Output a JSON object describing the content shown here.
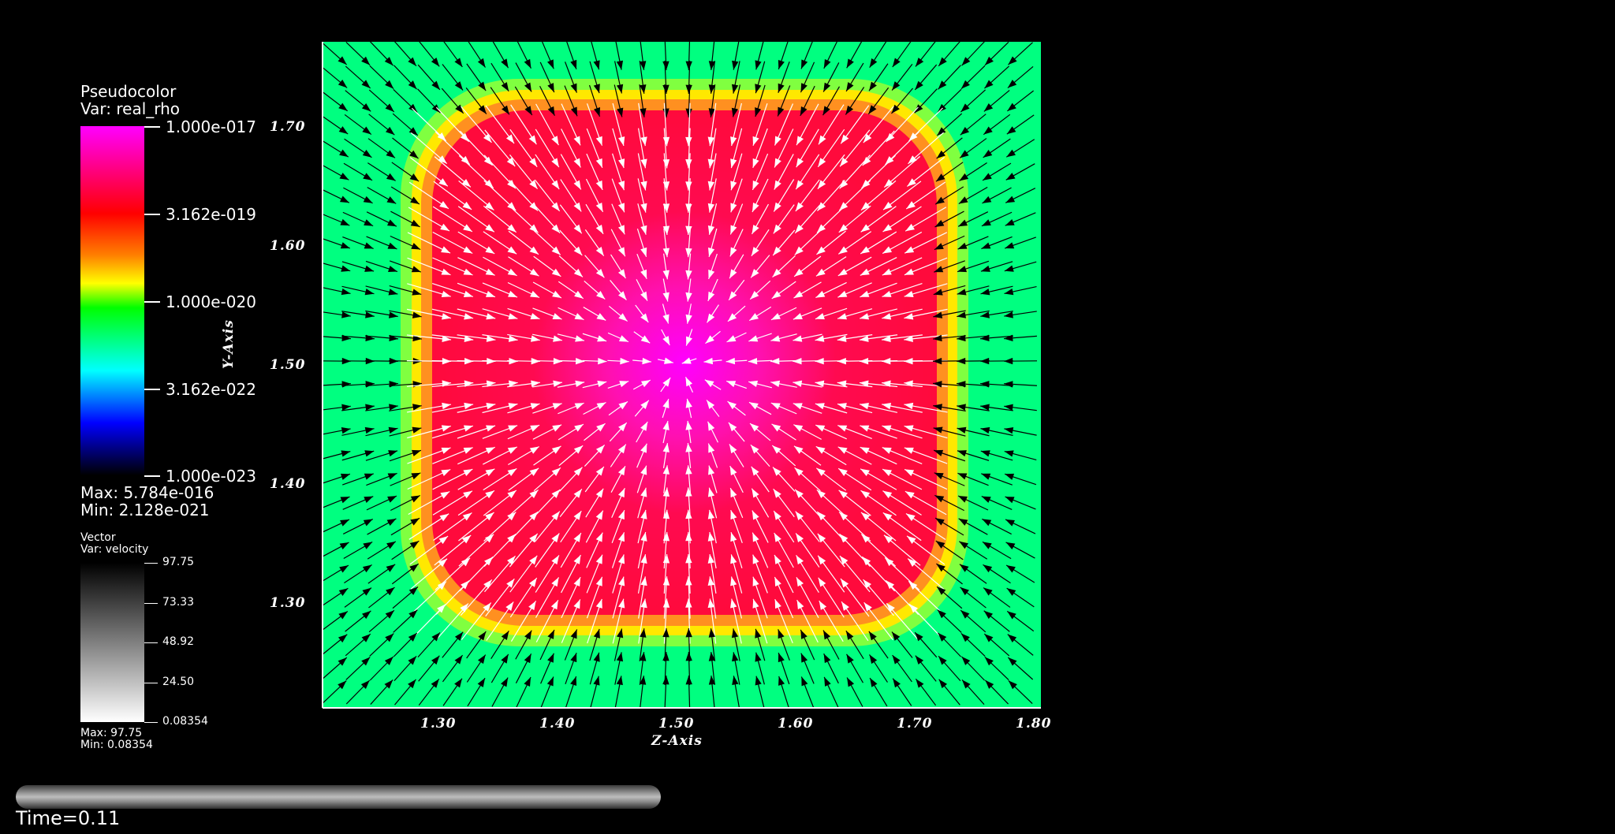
{
  "scalar_legend": {
    "plot_type": "Pseudocolor",
    "var_label": "Var: real_rho",
    "ticks": [
      "1.000e-017",
      "3.162e-019",
      "1.000e-020",
      "3.162e-022",
      "1.000e-023"
    ],
    "max_label": "Max:  5.784e-016",
    "min_label": "Min:  2.128e-021",
    "colormap": [
      "#ff00ff",
      "#ff0000",
      "#ffff00",
      "#00ff00",
      "#00ffff",
      "#0000ff",
      "#000000"
    ]
  },
  "vector_legend": {
    "plot_type": "Vector",
    "var_label": "Var: velocity",
    "ticks": [
      "97.75",
      "73.33",
      "48.92",
      "24.50",
      "0.08354"
    ],
    "max_label": "Max:  97.75",
    "min_label": "Min:  0.08354"
  },
  "plot": {
    "x_axis_title": "Z-Axis",
    "y_axis_title": "Y-Axis",
    "x_ticks": [
      "1.30",
      "1.40",
      "1.50",
      "1.60",
      "1.70",
      "1.80"
    ],
    "y_ticks": [
      "1.70",
      "1.60",
      "1.50",
      "1.40",
      "1.30"
    ],
    "x_range": [
      1.2,
      1.805
    ],
    "y_range": [
      1.21,
      1.77
    ],
    "background_color": "#00ff80",
    "core_color": "#ff0a3c",
    "center_color": "#ff00ff",
    "rim_color": "#ffe800"
  },
  "time": {
    "label": "Time=0.11"
  }
}
